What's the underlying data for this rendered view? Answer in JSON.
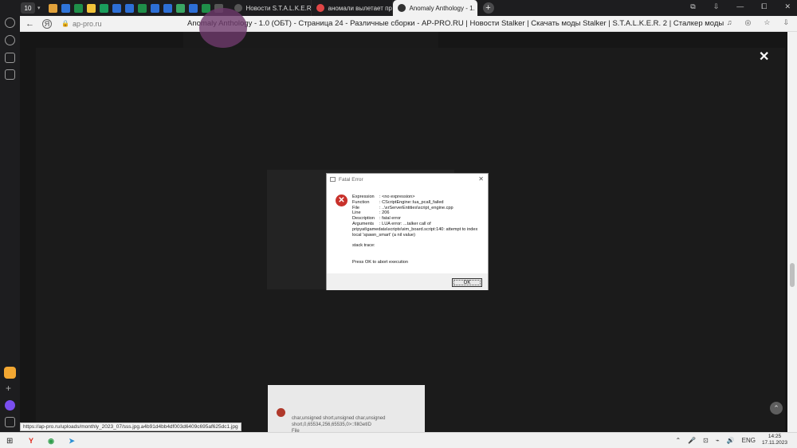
{
  "browser": {
    "tab_count": "10",
    "tabs": [
      {
        "label": "Новости S.T.A.L.K.E.R. - AP",
        "color": "#555"
      },
      {
        "label": "аномали вылетает при уб",
        "color": "#e04646"
      },
      {
        "label": "Anomaly Anthology - 1.",
        "color": "#333"
      }
    ],
    "pinned_colors": [
      "#e2a23b",
      "#2f74d8",
      "#1f8f49",
      "#f3c43a",
      "#1a9d5c",
      "#2d6fd6",
      "#2d6fd6",
      "#1f8f49",
      "#2d6fd6",
      "#2d6fd6",
      "#3aa663",
      "#2d6fd6",
      "#1f8f49",
      "#555"
    ],
    "new_tab": "+",
    "window_controls": [
      "⧉",
      "⇩",
      "—",
      "⧠",
      "✕"
    ],
    "back": "←",
    "domain": "ap-pro.ru",
    "lock": "🔒",
    "page_title": "Anomaly Anthology - 1.0 (ОБТ) - Страница 24 - Различные сборки - AP-PRO.RU | Новости Stalker | Скачать моды Stalker | S.T.A.L.K.E.R. 2 | Сталкер моды",
    "addr_icons": [
      "♫",
      "◎",
      "☆",
      "⇩"
    ]
  },
  "page": {
    "lightbox_close": "✕",
    "scroll_up": "⌃",
    "snippet_text": "char,unsigned short,unsigned char,unsigned\nshort,0,65534,256,65535,0>::fillGetID\nFile"
  },
  "status_url": "https://ap-pro.ru/uploads/monthly_2023_07/sss.jpg.a4b91d4bb4df003d6409c695af625dc1.jpg",
  "dialog": {
    "title": "Fatal Error",
    "close": "✕",
    "error_icon": "✕",
    "rows": [
      {
        "key": "Expression",
        "value": ": <no expression>"
      },
      {
        "key": "Function",
        "value": ": CScriptEngine::lua_pcall_failed"
      },
      {
        "key": "File",
        "value": ": ..\\xrServerEntities\\script_engine.cpp"
      },
      {
        "key": "Line",
        "value": ": 206"
      },
      {
        "key": "Description",
        "value": ": fatal error"
      },
      {
        "key": "Arguments",
        "value": ": LUA error: ...talker call of"
      }
    ],
    "arguments_cont": "pripyat\\gamedata\\scripts\\sim_board.script:140: attempt to index local 'spawn_smart' (a nil value)",
    "stack_trace": "stack trace:",
    "press_ok": "Press OK to abort execution",
    "ok_label": "OK"
  },
  "taskbar": {
    "start": "⊞",
    "apps": [
      {
        "name": "yandex-browser-icon",
        "glyph": "Y",
        "color": "#e0281c"
      },
      {
        "name": "chrome-icon",
        "glyph": "◉",
        "color": "#2e9c4a"
      },
      {
        "name": "telegram-icon",
        "glyph": "➤",
        "color": "#2a8fd4"
      }
    ],
    "tray": [
      "⌃",
      "🎤",
      "⊡",
      "⌁",
      "🔊",
      "ENG"
    ],
    "time": "14:25",
    "date": "17.11.2023"
  }
}
